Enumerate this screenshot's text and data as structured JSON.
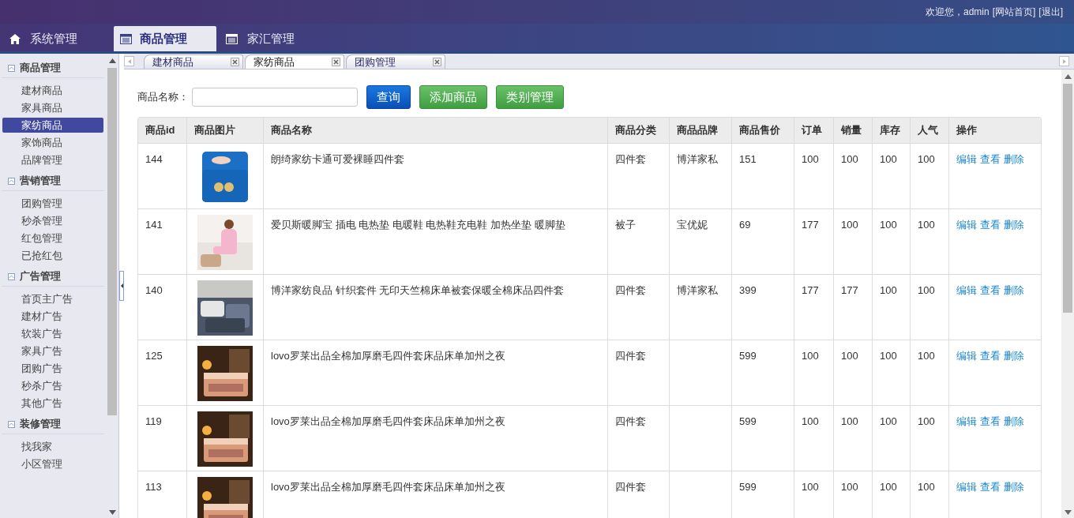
{
  "header": {
    "welcome": "欢迎您，admin",
    "links": [
      "[网站首页]",
      "[退出]"
    ]
  },
  "nav": [
    {
      "label": "系统管理",
      "kind": "home",
      "selected": false
    },
    {
      "label": "商品管理",
      "kind": "list",
      "selected": true
    },
    {
      "label": "家汇管理",
      "kind": "list",
      "selected": false
    }
  ],
  "sidebar": [
    {
      "title": "商品管理",
      "expanded": true,
      "items": [
        {
          "label": "建材商品",
          "selected": false
        },
        {
          "label": "家具商品",
          "selected": false
        },
        {
          "label": "家纺商品",
          "selected": true
        },
        {
          "label": "家饰商品",
          "selected": false
        },
        {
          "label": "品牌管理",
          "selected": false
        }
      ]
    },
    {
      "title": "营销管理",
      "expanded": true,
      "items": [
        {
          "label": "团购管理",
          "selected": false
        },
        {
          "label": "秒杀管理",
          "selected": false
        },
        {
          "label": "红包管理",
          "selected": false
        },
        {
          "label": "已抢红包",
          "selected": false
        }
      ]
    },
    {
      "title": "广告管理",
      "expanded": true,
      "items": [
        {
          "label": "首页主广告",
          "selected": false
        },
        {
          "label": "建材广告",
          "selected": false
        },
        {
          "label": "软装广告",
          "selected": false
        },
        {
          "label": "家具广告",
          "selected": false
        },
        {
          "label": "团购广告",
          "selected": false
        },
        {
          "label": "秒杀广告",
          "selected": false
        },
        {
          "label": "其他广告",
          "selected": false
        }
      ]
    },
    {
      "title": "装修管理",
      "expanded": true,
      "items": [
        {
          "label": "找我家",
          "selected": false
        },
        {
          "label": "小区管理",
          "selected": false
        }
      ]
    }
  ],
  "tabs": [
    {
      "label": "建材商品",
      "selected": false
    },
    {
      "label": "家纺商品",
      "selected": true
    },
    {
      "label": "团购管理",
      "selected": false
    }
  ],
  "search": {
    "label": "商品名称：",
    "buttons": [
      {
        "label": "查询",
        "kind": "primary"
      },
      {
        "label": "添加商品",
        "kind": "success"
      },
      {
        "label": "类别管理",
        "kind": "success"
      }
    ]
  },
  "table": {
    "columns": [
      "商品id",
      "商品图片",
      "商品名称",
      "商品分类",
      "商品品牌",
      "商品售价",
      "订单",
      "销量",
      "库存",
      "人气",
      "操作"
    ],
    "rows": [
      {
        "id": "144",
        "name": "朗绮家纺卡通可爱裸睡四件套",
        "category": "四件套",
        "brand": "博洋家私",
        "price": "151",
        "orders": "100",
        "sales": "100",
        "stock": "100",
        "popularity": "100",
        "actions": [
          "编辑",
          "查看",
          "删除"
        ]
      },
      {
        "id": "141",
        "name": "爱贝斯暖脚宝 插电 电热垫 电暖鞋 电热鞋充电鞋 加热坐垫 暖脚垫",
        "category": "被子",
        "brand": "宝优妮",
        "price": "69",
        "orders": "177",
        "sales": "100",
        "stock": "100",
        "popularity": "100",
        "actions": [
          "编辑",
          "查看",
          "删除"
        ]
      },
      {
        "id": "140",
        "name": "博洋家纺良品 针织套件 无印天竺棉床单被套保暖全棉床品四件套",
        "category": "四件套",
        "brand": "博洋家私",
        "price": "399",
        "orders": "177",
        "sales": "177",
        "stock": "100",
        "popularity": "100",
        "actions": [
          "编辑",
          "查看",
          "删除"
        ]
      },
      {
        "id": "125",
        "name": "lovo罗莱出品全棉加厚磨毛四件套床品床单加州之夜",
        "category": "四件套",
        "price": "599",
        "orders": "100",
        "sales": "100",
        "stock": "100",
        "popularity": "100",
        "actions": [
          "编辑",
          "查看",
          "删除"
        ]
      },
      {
        "id": "119",
        "name": "lovo罗莱出品全棉加厚磨毛四件套床品床单加州之夜",
        "category": "四件套",
        "price": "599",
        "orders": "100",
        "sales": "100",
        "stock": "100",
        "popularity": "100",
        "actions": [
          "编辑",
          "查看",
          "删除"
        ]
      },
      {
        "id": "113",
        "name": "lovo罗莱出品全棉加厚磨毛四件套床品床单加州之夜",
        "category": "四件套",
        "price": "599",
        "orders": "100",
        "sales": "100",
        "stock": "100",
        "popularity": "100",
        "actions": [
          "编辑",
          "查看",
          "删除"
        ]
      }
    ]
  }
}
